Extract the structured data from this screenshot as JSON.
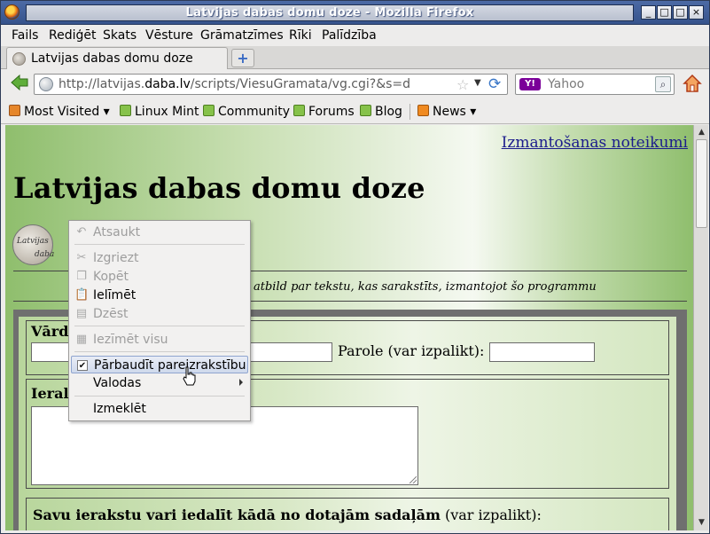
{
  "window": {
    "title": "Latvijas dabas domu doze - Mozilla Firefox",
    "buttons": [
      "_",
      "□",
      "□",
      "×"
    ]
  },
  "menubar": {
    "items": [
      {
        "label": "Fails"
      },
      {
        "label": "Rediģēt"
      },
      {
        "label": "Skats"
      },
      {
        "label": "Vēsture"
      },
      {
        "label": "Grāmatzīmes"
      },
      {
        "label": "Rīki"
      },
      {
        "label": "Palīdzība"
      }
    ]
  },
  "tabs": [
    {
      "label": "Latvijas dabas domu doze"
    }
  ],
  "newtab_label": "+",
  "navbar": {
    "url_prefix": "http://latvijas.",
    "url_domain": "daba.lv",
    "url_suffix": "/scripts/ViesuGramata/vg.cgi?&s=d",
    "search_placeholder": "Yahoo",
    "search_engine_badge": "Y!"
  },
  "bookmarks": [
    {
      "label": "Most Visited",
      "icon": "most-visited-icon",
      "dropdown": true
    },
    {
      "label": "Linux Mint",
      "icon": "mint-icon"
    },
    {
      "label": "Community",
      "icon": "mint-icon"
    },
    {
      "label": "Forums",
      "icon": "mint-icon"
    },
    {
      "label": "Blog",
      "icon": "mint-icon"
    },
    {
      "label": "News",
      "icon": "rss-icon",
      "dropdown": true
    }
  ],
  "page": {
    "terms_link": "Izmantošanas noteikumi",
    "title": "Latvijas dabas domu doze",
    "logo_line1": "Latvijas",
    "logo_line2": "daba",
    "notice_visible": "atbild par tekstu, kas sarakstīts, izmantojot šo programmu",
    "name_label_visible": "Vārd",
    "password_label": "Parole (var izpalikt):",
    "entry_label_visible": "Ieral",
    "section_bold": "Savu ierakstu vari iedalīt kādā no dotajām sadaļām",
    "section_rest": "(var izpalikt):"
  },
  "context_menu": {
    "items": [
      {
        "label": "Atsaukt",
        "icon": "undo-icon",
        "enabled": false
      },
      {
        "label": "Izgriezt",
        "icon": "scissors-icon",
        "enabled": false
      },
      {
        "label": "Kopēt",
        "icon": "copy-icon",
        "enabled": false
      },
      {
        "label": "Ielīmēt",
        "icon": "paste-icon",
        "enabled": true
      },
      {
        "label": "Dzēst",
        "icon": "delete-icon",
        "enabled": false
      },
      {
        "label": "Iezīmēt visu",
        "icon": "select-all-icon",
        "enabled": false
      },
      {
        "label": "Pārbaudīt pareizrakstību",
        "checked": true,
        "enabled": true,
        "highlighted": true
      },
      {
        "label": "Valodas",
        "submenu": true,
        "enabled": true
      },
      {
        "label": "Izmeklēt",
        "enabled": true
      }
    ]
  },
  "colors": {
    "titlebar": "#3d5a95",
    "link": "#1b1b8c",
    "page_green": "#8fbe6d"
  }
}
